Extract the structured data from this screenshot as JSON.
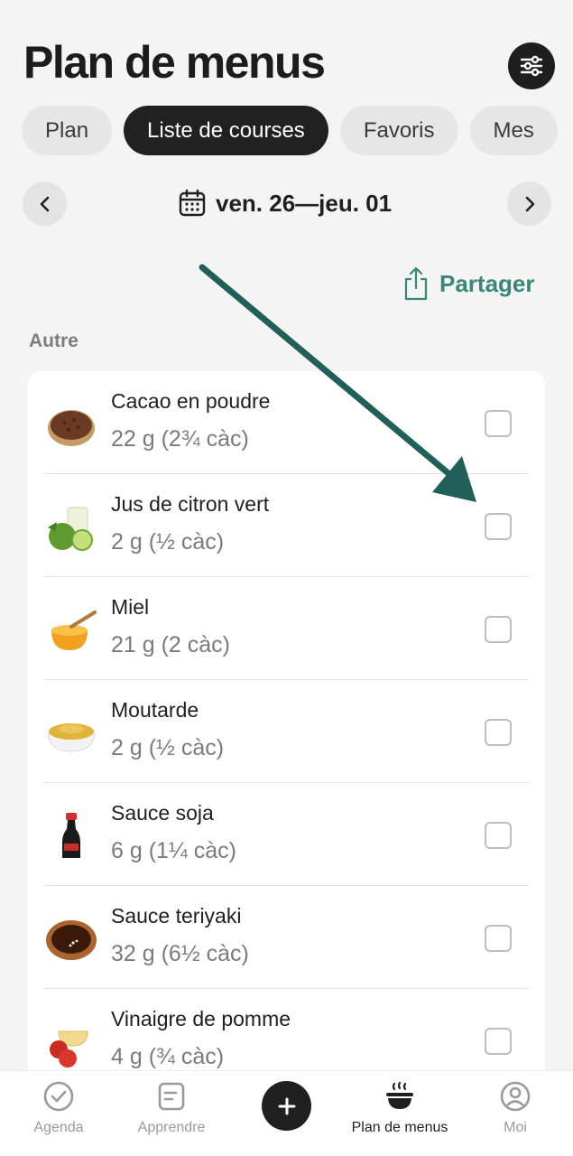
{
  "header": {
    "title": "Plan de menus"
  },
  "tabs": [
    {
      "label": "Plan"
    },
    {
      "label": "Liste de courses"
    },
    {
      "label": "Favoris"
    },
    {
      "label": "Mes"
    }
  ],
  "date_range": "ven. 26—jeu. 01",
  "share_label": "Partager",
  "section": "Autre",
  "items": [
    {
      "name": "Cacao en poudre",
      "qty": "22 g (2¾ càc)",
      "checked": false
    },
    {
      "name": "Jus de citron vert",
      "qty": "2 g (½ càc)",
      "checked": false
    },
    {
      "name": "Miel",
      "qty": "21 g (2 càc)",
      "checked": false
    },
    {
      "name": "Moutarde",
      "qty": "2 g (½ càc)",
      "checked": false
    },
    {
      "name": "Sauce soja",
      "qty": "6 g (1¼ càc)",
      "checked": false
    },
    {
      "name": "Sauce teriyaki",
      "qty": "32 g (6½ càc)",
      "checked": false
    },
    {
      "name": "Vinaigre de pomme",
      "qty": "4 g (¾ càc)",
      "checked": false
    }
  ],
  "bottom_nav": [
    {
      "label": "Agenda",
      "icon": "check-circle-icon"
    },
    {
      "label": "Apprendre",
      "icon": "note-icon"
    },
    {
      "label": "Plan de menus",
      "icon": "bowl-icon",
      "active": true
    },
    {
      "label": "Moi",
      "icon": "user-circle-icon"
    }
  ],
  "colors": {
    "accent": "#3a8778",
    "annotation_arrow": "#225f58",
    "dark": "#202020"
  }
}
